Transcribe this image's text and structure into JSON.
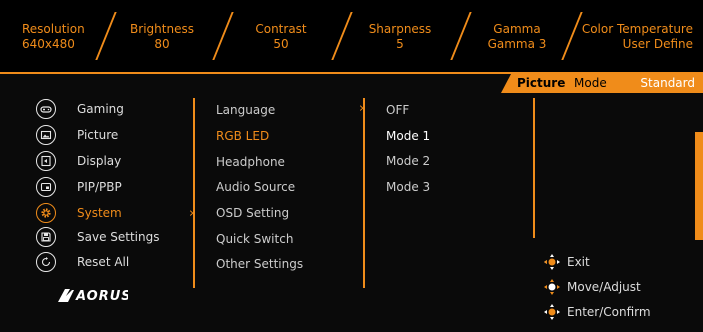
{
  "status_bar": [
    {
      "label": "Resolution",
      "value": "640x480"
    },
    {
      "label": "Brightness",
      "value": "80"
    },
    {
      "label": "Contrast",
      "value": "50"
    },
    {
      "label": "Sharpness",
      "value": "5"
    },
    {
      "label": "Gamma",
      "value": "Gamma 3"
    },
    {
      "label": "Color Temperature",
      "value": "User Define"
    }
  ],
  "picture_mode": {
    "title": "Picture",
    "label": "Mode",
    "value": "Standard"
  },
  "main_menu": [
    {
      "label": "Gaming",
      "icon": "gamepad-icon"
    },
    {
      "label": "Picture",
      "icon": "picture-icon"
    },
    {
      "label": "Display",
      "icon": "display-icon"
    },
    {
      "label": "PIP/PBP",
      "icon": "pip-icon"
    },
    {
      "label": "System",
      "icon": "gear-icon",
      "active": true
    },
    {
      "label": "Save Settings",
      "icon": "save-icon"
    },
    {
      "label": "Reset All",
      "icon": "reset-icon"
    }
  ],
  "submenu": [
    {
      "label": "Language"
    },
    {
      "label": "RGB LED",
      "active": true
    },
    {
      "label": "Headphone"
    },
    {
      "label": "Audio Source"
    },
    {
      "label": "OSD Setting"
    },
    {
      "label": "Quick Switch"
    },
    {
      "label": "Other Settings"
    }
  ],
  "options": [
    {
      "label": "OFF"
    },
    {
      "label": "Mode 1",
      "current": true
    },
    {
      "label": "Mode 2"
    },
    {
      "label": "Mode 3"
    }
  ],
  "hints": [
    {
      "label": "Exit",
      "icon": "joystick-exit-icon"
    },
    {
      "label": "Move/Adjust",
      "icon": "joystick-move-icon"
    },
    {
      "label": "Enter/Confirm",
      "icon": "joystick-enter-icon"
    }
  ],
  "brand": {
    "logo_text": "AORUS"
  },
  "colors": {
    "accent": "#f08c1a",
    "background": "#000000"
  }
}
